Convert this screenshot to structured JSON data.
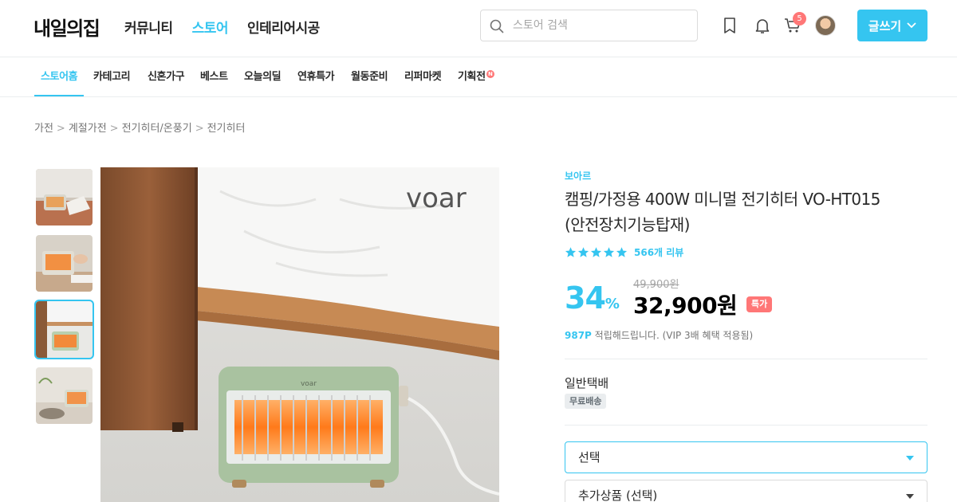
{
  "header": {
    "logo": "내일의집",
    "nav": [
      "커뮤니티",
      "스토어",
      "인테리어시공"
    ],
    "active_nav": "스토어",
    "search_placeholder": "스토어 검색",
    "cart_count": "5",
    "write_label": "글쓰기",
    "accent_color": "#35c5f0"
  },
  "subnav": {
    "items": [
      "스토어홈",
      "카테고리",
      "신혼가구",
      "베스트",
      "오늘의딜",
      "연휴특가",
      "월동준비",
      "리퍼마켓",
      "기획전"
    ],
    "new_badge": "N"
  },
  "breadcrumb": [
    "가전",
    "계절가전",
    "전기히터/온풍기",
    "전기히터"
  ],
  "gallery": {
    "thumbnail_count": 4,
    "selected_index": 2,
    "main_image_logo": "voar",
    "heater_logo": "voar"
  },
  "product": {
    "brand": "보아르",
    "title": "캠핑/가정용 400W 미니멀 전기히터 VO-HT015 (안전장치기능탑재)",
    "rating_stars": 5,
    "review_count": "566개 리뷰",
    "discount_percent": "34",
    "percent_symbol": "%",
    "original_price": "49,900원",
    "price": "32,900원",
    "special_tag": "특가",
    "points": "987P",
    "points_text": " 적립해드립니다. (VIP 3배 혜택 적용됨)",
    "shipping_type": "일반택배",
    "shipping_badge": "무료배송",
    "option_select": "선택",
    "addon_select": "추가상품 (선택)"
  }
}
